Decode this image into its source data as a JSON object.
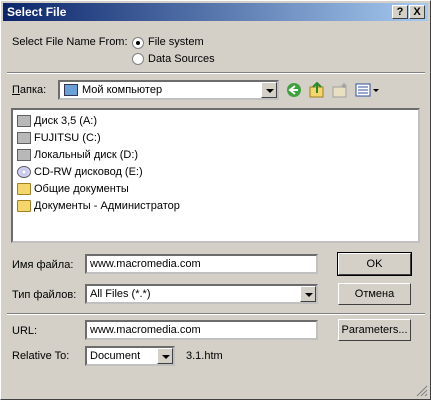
{
  "window": {
    "title": "Select File",
    "help_label": "?",
    "close_label": "X"
  },
  "source": {
    "label": "Select File Name From:",
    "options": [
      {
        "label": "File system",
        "selected": true
      },
      {
        "label": "Data Sources",
        "selected": false
      }
    ]
  },
  "folder": {
    "label": "Папка:",
    "selected": "Мой компьютер"
  },
  "toolbar": {
    "icons": [
      "back-icon",
      "up-folder-icon",
      "new-folder-icon",
      "view-menu-icon"
    ]
  },
  "file_list": {
    "items": [
      {
        "label": "Диск 3,5 (A:)",
        "icon": "floppy-drive-icon"
      },
      {
        "label": "FUJITSU (C:)",
        "icon": "hard-drive-icon"
      },
      {
        "label": "Локальный диск (D:)",
        "icon": "hard-drive-icon"
      },
      {
        "label": "CD-RW дисковод (E:)",
        "icon": "cd-drive-icon"
      },
      {
        "label": "Общие документы",
        "icon": "folder-icon"
      },
      {
        "label": "Документы - Администратор",
        "icon": "folder-icon"
      }
    ]
  },
  "filename": {
    "label": "Имя файла:",
    "value": "www.macromedia.com"
  },
  "filetype": {
    "label": "Тип файлов:",
    "value": "All Files (*.*)"
  },
  "buttons": {
    "ok": "OK",
    "cancel": "Отмена",
    "parameters": "Parameters..."
  },
  "url": {
    "label": "URL:",
    "value": "www.macromedia.com"
  },
  "relative": {
    "label": "Relative To:",
    "value": "Document",
    "file": "3.1.htm"
  }
}
